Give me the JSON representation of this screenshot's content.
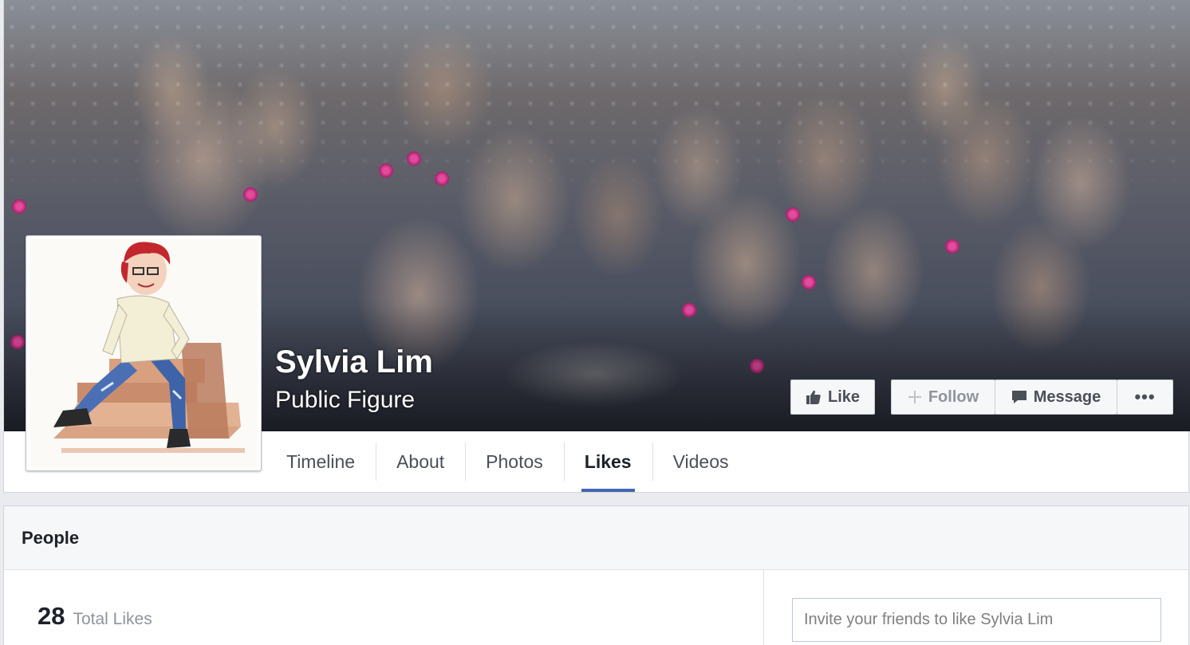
{
  "profile": {
    "name": "Sylvia Lim",
    "category": "Public Figure"
  },
  "actions": {
    "like_label": "Like",
    "follow_label": "Follow",
    "message_label": "Message",
    "more_label": "•••"
  },
  "tabs": [
    {
      "label": "Timeline",
      "active": false
    },
    {
      "label": "About",
      "active": false
    },
    {
      "label": "Photos",
      "active": false
    },
    {
      "label": "Likes",
      "active": true
    },
    {
      "label": "Videos",
      "active": false
    }
  ],
  "people": {
    "heading": "People",
    "total_likes_count": "28",
    "total_likes_label": "Total Likes",
    "invite_placeholder": "Invite your friends to like Sylvia Lim"
  },
  "colors": {
    "accent": "#4267b2",
    "page_background": "#e9ebee",
    "button_background": "#f6f7f9",
    "text_primary": "#1d2129",
    "text_secondary": "#90949c"
  },
  "icons": {
    "like": "thumbs-up-icon",
    "follow": "plus-icon",
    "message": "speech-bubble-icon",
    "more": "ellipsis-icon"
  }
}
